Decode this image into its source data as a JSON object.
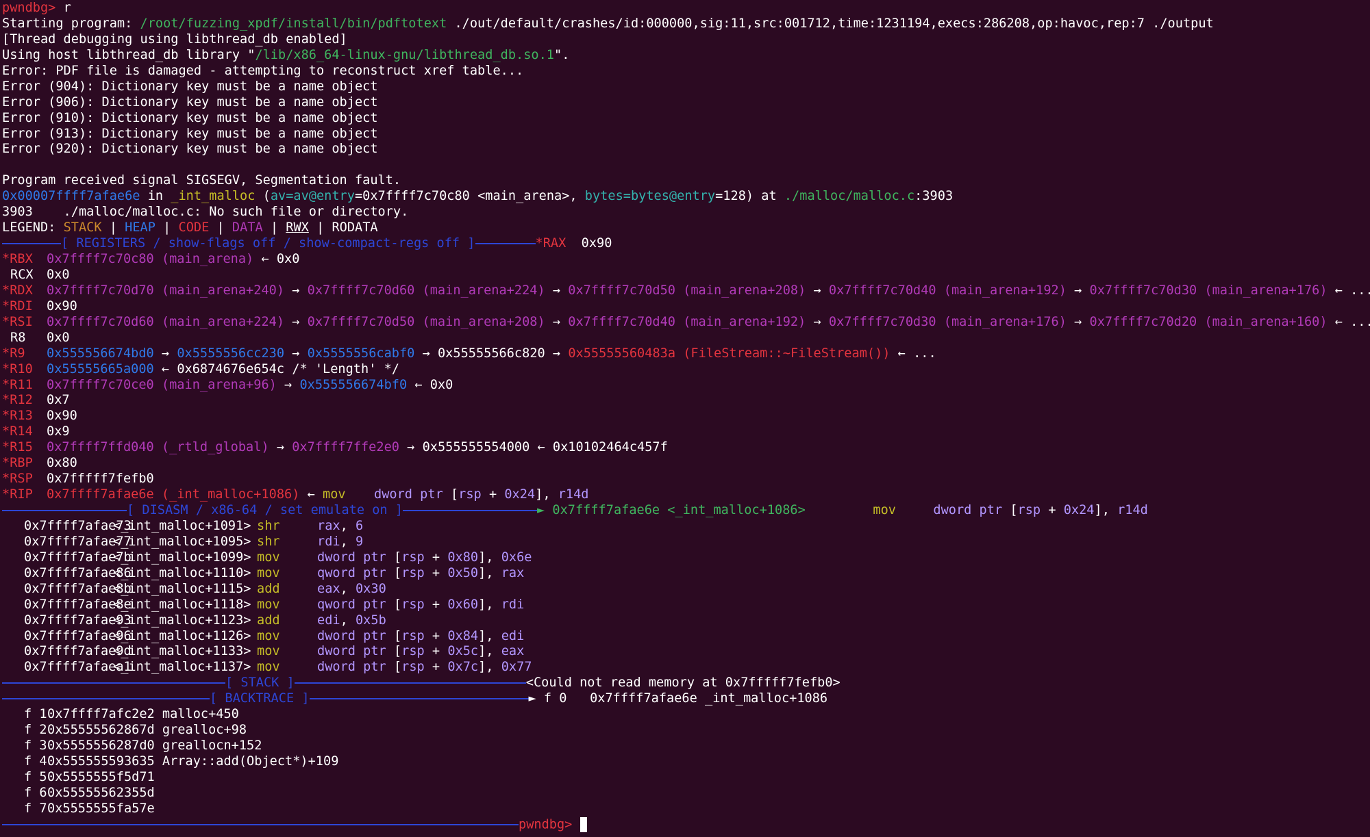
{
  "line_prompt": {
    "prompt": "pwndbg>",
    "command": " r"
  },
  "line_start": {
    "label": "Starting program: ",
    "program": "/root/fuzzing_xpdf/install/bin/pdftotext",
    "args": " ./out/default/crashes/id:000000,sig:11,src:001712,time:1231194,execs:286208,op:havoc,rep:7 ./output"
  },
  "line_thread": "[Thread debugging using libthread_db enabled]",
  "line_libthread": {
    "pre": "Using host libthread_db library \"",
    "path": "/lib/x86_64-linux-gnu/libthread_db.so.1",
    "post": "\"."
  },
  "errors": [
    "Error: PDF file is damaged - attempting to reconstruct xref table...",
    "Error (904): Dictionary key must be a name object",
    "Error (906): Dictionary key must be a name object",
    "Error (910): Dictionary key must be a name object",
    "Error (913): Dictionary key must be a name object",
    "Error (920): Dictionary key must be a name object"
  ],
  "line_signal": "Program received signal SIGSEGV, Segmentation fault.",
  "line_frame": {
    "addr": "0x00007ffff7afae6e",
    "in": " in ",
    "func": "_int_malloc",
    "open": " (",
    "arg1": "av=av@entry",
    "arg1v": "=0x7ffff7c70c80 <main_arena>, ",
    "arg2": "bytes=bytes@entry",
    "arg2v": "=128) at ",
    "file": "./malloc/malloc.c",
    "line": ":3903"
  },
  "line_nosuch": "3903    ./malloc/malloc.c: No such file or directory.",
  "legend": {
    "label": "LEGEND: ",
    "stack": "STACK",
    "heap": "HEAP",
    "code": "CODE",
    "data": "DATA",
    "rwx": "RWX",
    "rodata": "RODATA",
    "sep": " | "
  },
  "hdr_registers": {
    "title": "[ REGISTERS / show-flags off / show-compact-regs off ]",
    "reg": "*RAX",
    "val": "  0x90"
  },
  "registers": {
    "rbx": {
      "name": "*RBX",
      "v1": "0x7ffff7c70c80 (main_arena)",
      "a1": " ← ",
      "v2": "0x0"
    },
    "rcx": {
      "name": "RCX",
      "v1": "0x0"
    },
    "rdx": {
      "name": "*RDX",
      "v1": "0x7ffff7c70d70 (main_arena+240)",
      "v2": "0x7ffff7c70d60 (main_arena+224)",
      "v3": "0x7ffff7c70d50 (main_arena+208)",
      "v4": "0x7ffff7c70d40 (main_arena+192)",
      "v5": "0x7ffff7c70d30 (main_arena+176)",
      "arrow": " → ",
      "tail": " ← ..."
    },
    "rdi": {
      "name": "*RDI",
      "v1": "0x90"
    },
    "rsi": {
      "name": "*RSI",
      "v1": "0x7ffff7c70d60 (main_arena+224)",
      "v2": "0x7ffff7c70d50 (main_arena+208)",
      "v3": "0x7ffff7c70d40 (main_arena+192)",
      "v4": "0x7ffff7c70d30 (main_arena+176)",
      "v5": "0x7ffff7c70d20 (main_arena+160)",
      "arrow": " → ",
      "tail": " ← ..."
    },
    "r8": {
      "name": "R8",
      "v1": "0x0"
    },
    "r9": {
      "name": "*R9",
      "v1": "0x555556674bd0",
      "v2": "0x5555556cc230",
      "v3": "0x5555556cabf0",
      "v4": "0x55555566c820",
      "v5": "0x55555560483a (FileStream::~FileStream())",
      "arrow": " → ",
      "tail": " ← ..."
    },
    "r10": {
      "name": "*R10",
      "v1": "0x55555665a000",
      "a1": " ← ",
      "v2": "0x6874676e654c /* 'Length' */"
    },
    "r11": {
      "name": "*R11",
      "v1": "0x7ffff7c70ce0 (main_arena+96)",
      "a1": " → ",
      "v2": "0x555556674bf0",
      "a2": " ← ",
      "v3": "0x0"
    },
    "r12": {
      "name": "*R12",
      "v1": "0x7"
    },
    "r13": {
      "name": "*R13",
      "v1": "0x90"
    },
    "r14": {
      "name": "*R14",
      "v1": "0x9"
    },
    "r15": {
      "name": "*R15",
      "v1": "0x7ffff7ffd040 (_rtld_global)",
      "a1": " → ",
      "v2": "0x7ffff7ffe2e0",
      "a2": " → ",
      "v3": "0x555555554000",
      "a3": " ← ",
      "v4": "0x10102464c457f"
    },
    "rbp": {
      "name": "*RBP",
      "v1": "0x80"
    },
    "rsp": {
      "name": "*RSP",
      "v1": "0x7fffff7fefb0"
    },
    "rip": {
      "name": "*RIP",
      "v1": "0x7ffff7afae6e (_int_malloc+1086)",
      "a1": " ← ",
      "mn": "mov",
      "op1": "dword ptr",
      "op2": " [",
      "op3": "rsp",
      "op4": " + ",
      "op5": "0x24",
      "op6": "], ",
      "op7": "r14d"
    }
  },
  "hdr_disasm": {
    "title": "[ DISASM / x86-64 / set emulate on ]",
    "marker": "► ",
    "addr": "0x7ffff7afae6e <_int_malloc+1086>",
    "mn": "mov",
    "op1": "dword ptr",
    "op2": " [",
    "op3": "rsp",
    "op4": " + ",
    "op5": "0x24",
    "op6": "], ",
    "op7": "r14d"
  },
  "disasm": [
    {
      "addr": "0x7ffff7afae73",
      "sym": "<_int_malloc+1091>",
      "mn": "shr",
      "o1": "rax",
      "o2": ", ",
      "o3": "6"
    },
    {
      "addr": "0x7ffff7afae77",
      "sym": "<_int_malloc+1095>",
      "mn": "shr",
      "o1": "rdi",
      "o2": ", ",
      "o3": "9"
    },
    {
      "addr": "0x7ffff7afae7b",
      "sym": "<_int_malloc+1099>",
      "mn": "mov",
      "p1": "dword ptr",
      "p2": " [",
      "p3": "rsp",
      "p4": " + ",
      "p5": "0x80",
      "p6": "], ",
      "p7": "0x6e"
    },
    {
      "addr": "0x7ffff7afae86",
      "sym": "<_int_malloc+1110>",
      "mn": "mov",
      "p1": "qword ptr",
      "p2": " [",
      "p3": "rsp",
      "p4": " + ",
      "p5": "0x50",
      "p6": "], ",
      "p7": "rax"
    },
    {
      "addr": "0x7ffff7afae8b",
      "sym": "<_int_malloc+1115>",
      "mn": "add",
      "o1": "eax",
      "o2": ", ",
      "o3": "0x30"
    },
    {
      "addr": "0x7ffff7afae8e",
      "sym": "<_int_malloc+1118>",
      "mn": "mov",
      "p1": "qword ptr",
      "p2": " [",
      "p3": "rsp",
      "p4": " + ",
      "p5": "0x60",
      "p6": "], ",
      "p7": "rdi"
    },
    {
      "addr": "0x7ffff7afae93",
      "sym": "<_int_malloc+1123>",
      "mn": "add",
      "o1": "edi",
      "o2": ", ",
      "o3": "0x5b"
    },
    {
      "addr": "0x7ffff7afae96",
      "sym": "<_int_malloc+1126>",
      "mn": "mov",
      "p1": "dword ptr",
      "p2": " [",
      "p3": "rsp",
      "p4": " + ",
      "p5": "0x84",
      "p6": "], ",
      "p7": "edi"
    },
    {
      "addr": "0x7ffff7afae9d",
      "sym": "<_int_malloc+1133>",
      "mn": "mov",
      "p1": "dword ptr",
      "p2": " [",
      "p3": "rsp",
      "p4": " + ",
      "p5": "0x5c",
      "p6": "], ",
      "p7": "eax"
    },
    {
      "addr": "0x7ffff7afaea1",
      "sym": "<_int_malloc+1137>",
      "mn": "mov",
      "p1": "dword ptr",
      "p2": " [",
      "p3": "rsp",
      "p4": " + ",
      "p5": "0x7c",
      "p6": "], ",
      "p7": "0x77"
    }
  ],
  "hdr_stack": {
    "title": "[ STACK ]",
    "msg": "<Could not read memory at 0x7fffff7fefb0>"
  },
  "hdr_backtrace": {
    "title": "[ BACKTRACE ]",
    "frame": "► f 0   0x7ffff7afae6e _int_malloc+1086"
  },
  "backtrace": [
    {
      "f": "f 1",
      "text": "0x7ffff7afc2e2 malloc+450"
    },
    {
      "f": "f 2",
      "text": "0x55555562867d grealloc+98"
    },
    {
      "f": "f 3",
      "text": "0x5555556287d0 greallocn+152"
    },
    {
      "f": "f 4",
      "text": "0x555555593635 Array::add(Object*)+109"
    },
    {
      "f": "f 5",
      "text": "0x5555555f5d71"
    },
    {
      "f": "f 6",
      "text": "0x55555562355d"
    },
    {
      "f": "f 7",
      "text": "0x5555555fa57e"
    }
  ],
  "final_prompt": "pwndbg>"
}
